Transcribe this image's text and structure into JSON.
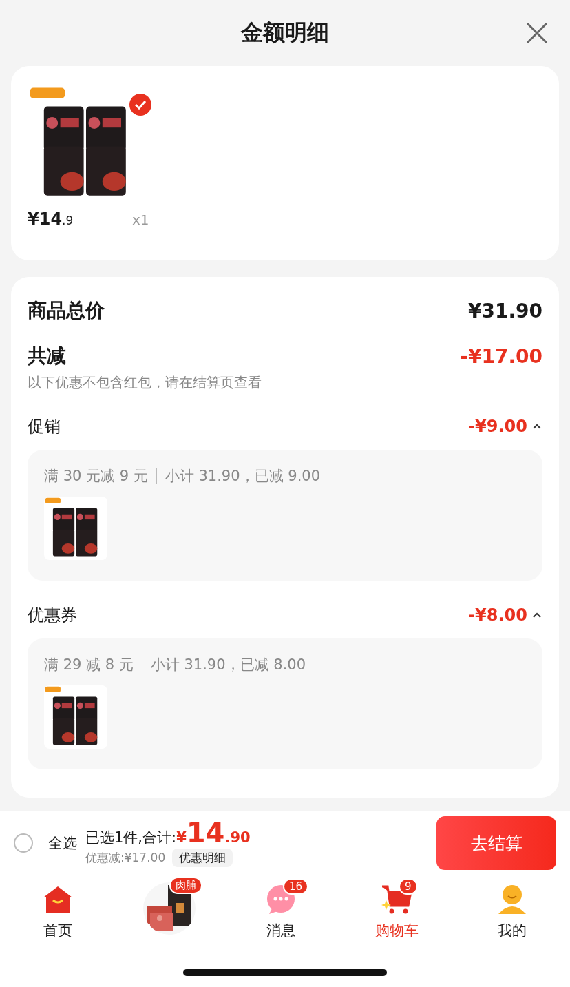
{
  "header": {
    "title": "金额明细"
  },
  "product": {
    "price_main": "¥14",
    "price_decimal": ".9",
    "quantity": "x1",
    "checked": true,
    "kind": "picture"
  },
  "summary": {
    "total_label": "商品总价",
    "total": "¥31.90",
    "reduction_label": "共减",
    "reduction": "-¥17.00",
    "note": "以下优惠不包含红包，请在结算页查看"
  },
  "discounts": [
    {
      "label": "促销",
      "amount": "-¥9.00",
      "expanded": true,
      "rule": "满 30 元减 9 元",
      "detail": "小计 31.90，已减 9.00"
    },
    {
      "label": "优惠券",
      "amount": "-¥8.00",
      "expanded": true,
      "rule": "满 29 减 8 元",
      "detail": "小计 31.90，已减 8.00"
    }
  ],
  "checkout_bar": {
    "select_all": {
      "label": "全选",
      "checked": false
    },
    "selected_text": "已选1件,合计:",
    "currency": "¥",
    "total_main": "14",
    "total_decimal": ".90",
    "saving": "优惠减:¥17.00",
    "detail_button": "优惠明细",
    "checkout_button": "去结算"
  },
  "tabs": [
    {
      "kind": "home",
      "label": "首页",
      "selected": false
    },
    {
      "kind": "promo",
      "badge": "肉脯"
    },
    {
      "kind": "message",
      "label": "消息",
      "badge": "16",
      "selected": false
    },
    {
      "kind": "cart",
      "label": "购物车",
      "badge": "9",
      "selected": true
    },
    {
      "kind": "profile",
      "label": "我的",
      "selected": false
    }
  ]
}
